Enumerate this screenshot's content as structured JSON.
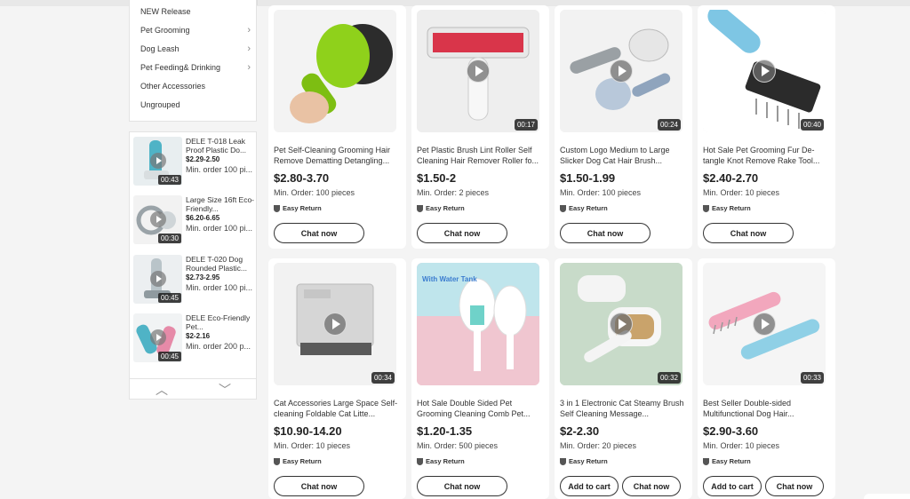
{
  "categories": [
    {
      "label": "NEW Release",
      "has_submenu": false
    },
    {
      "label": "Pet Grooming",
      "has_submenu": true
    },
    {
      "label": "Dog Leash",
      "has_submenu": true
    },
    {
      "label": "Pet Feeding& Drinking",
      "has_submenu": true
    },
    {
      "label": "Other Accessories",
      "has_submenu": false
    },
    {
      "label": "Ungrouped",
      "has_submenu": false
    }
  ],
  "recommendations": [
    {
      "title": "DELE T-018 Leak Proof Plastic Do...",
      "price": "$2.29-2.50",
      "min_order": "Min. order 100 pi...",
      "duration": "00:43"
    },
    {
      "title": "Large Size 16ft Eco-Friendly...",
      "price": "$6.20-6.65",
      "min_order": "Min. order 100 pi...",
      "duration": "00:30"
    },
    {
      "title": "DELE T-020 Dog Rounded Plastic...",
      "price": "$2.73-2.95",
      "min_order": "Min. order 100 pi...",
      "duration": "00:45"
    },
    {
      "title": "DELE Eco-Friendly Pet...",
      "price": "$2-2.16",
      "min_order": "Min. order 200 p...",
      "duration": "00:45"
    }
  ],
  "products": [
    {
      "title": "Pet Self-Cleaning Grooming Hair Remove Dematting Detangling...",
      "price": "$2.80-3.70",
      "min_order": "Min. Order: 100 pieces",
      "badge": "Easy Return",
      "duration": "",
      "chat_label": "Chat now",
      "cart_label": ""
    },
    {
      "title": "Pet Plastic Brush Lint Roller Self Cleaning Hair Remover Roller fo...",
      "price": "$1.50-2",
      "min_order": "Min. Order: 2 pieces",
      "badge": "Easy Return",
      "duration": "00:17",
      "chat_label": "Chat now",
      "cart_label": ""
    },
    {
      "title": "Custom Logo Medium to Large Slicker Dog Cat Hair Brush...",
      "price": "$1.50-1.99",
      "min_order": "Min. Order: 100 pieces",
      "badge": "Easy Return",
      "duration": "00:24",
      "chat_label": "Chat now",
      "cart_label": ""
    },
    {
      "title": "Hot Sale Pet Grooming Fur De-tangle Knot Remove Rake Tool...",
      "price": "$2.40-2.70",
      "min_order": "Min. Order: 10 pieces",
      "badge": "Easy Return",
      "duration": "00:40",
      "chat_label": "Chat now",
      "cart_label": ""
    },
    {
      "title": "Cat Accessories Large Space Self-cleaning Foldable Cat Litte...",
      "price": "$10.90-14.20",
      "min_order": "Min. Order: 10 pieces",
      "badge": "Easy Return",
      "duration": "00:34",
      "chat_label": "Chat now",
      "cart_label": ""
    },
    {
      "title": "Hot Sale Double Sided Pet Grooming Cleaning Comb Pet...",
      "price": "$1.20-1.35",
      "min_order": "Min. Order: 500 pieces",
      "badge": "Easy Return",
      "duration": "",
      "image_caption": "With Water Tank",
      "chat_label": "Chat now",
      "cart_label": ""
    },
    {
      "title": "3 in 1 Electronic Cat Steamy Brush Self Cleaning Message...",
      "price": "$2-2.30",
      "min_order": "Min. Order: 20 pieces",
      "badge": "Easy Return",
      "duration": "00:32",
      "chat_label": "Chat now",
      "cart_label": "Add to cart"
    },
    {
      "title": "Best Seller Double-sided Multifunctional Dog Hair...",
      "price": "$2.90-3.60",
      "min_order": "Min. Order: 10 pieces",
      "badge": "Easy Return",
      "duration": "00:33",
      "chat_label": "Chat now",
      "cart_label": "Add to cart"
    }
  ],
  "colors": {
    "page_bg": "#f4f4f4",
    "card_bg": "#ffffff",
    "text": "#222222"
  }
}
